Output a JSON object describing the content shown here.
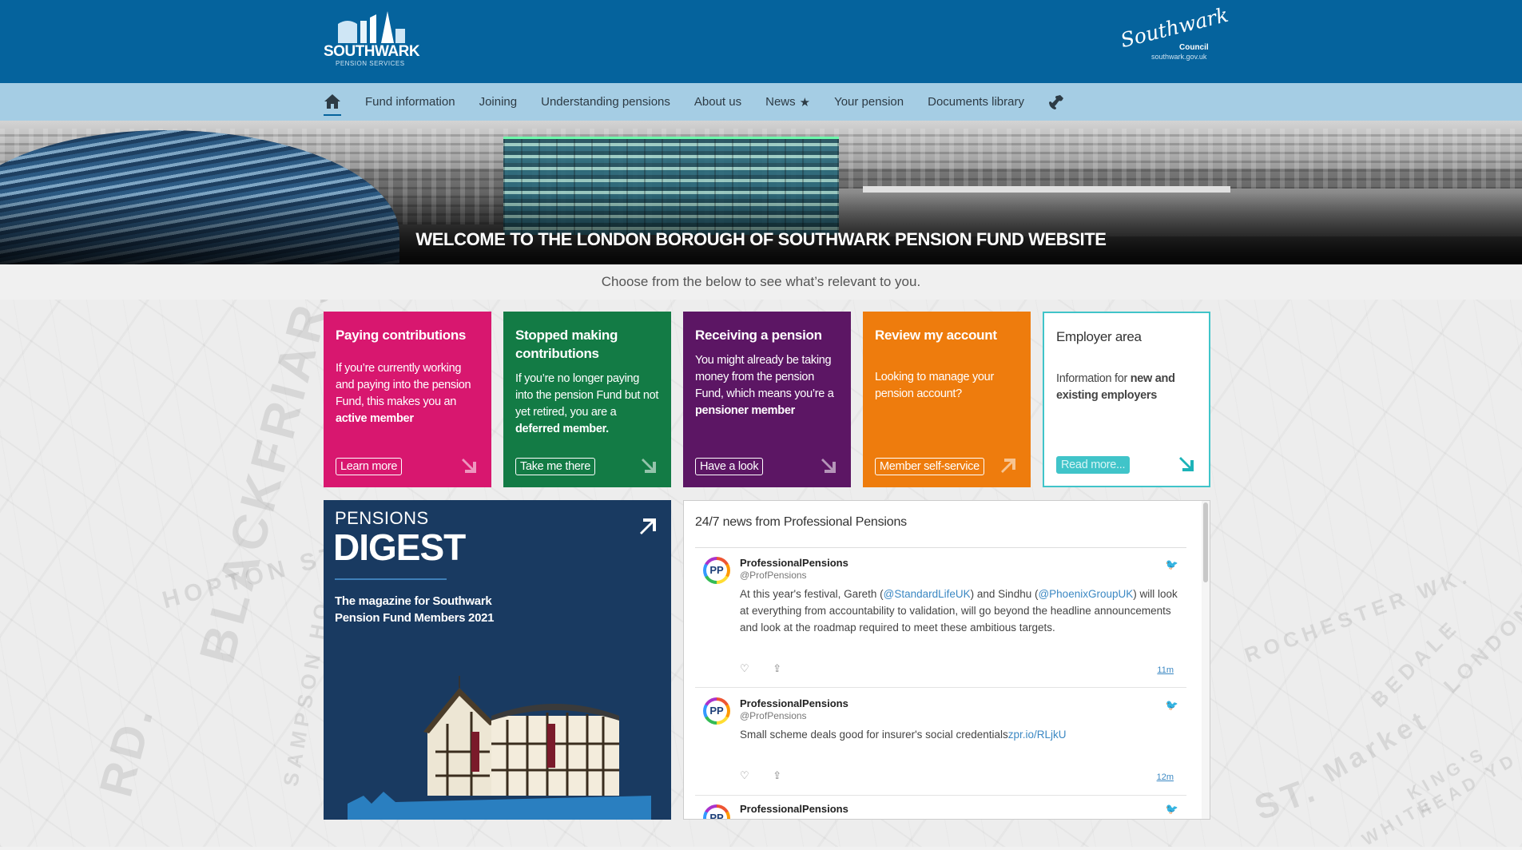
{
  "header": {
    "logo_main": "SOUTHWARK",
    "logo_sub": "PENSION SERVICES",
    "council_script": "Southwark",
    "council_label": "Council",
    "council_url": "southwark.gov.uk",
    "brand_color": "#05639d",
    "nav_color": "#a5cde4"
  },
  "nav": {
    "items": [
      "Fund information",
      "Joining",
      "Understanding pensions",
      "About us",
      "News",
      "Your pension",
      "Documents library"
    ],
    "icons": {
      "home": "home-icon",
      "news": "star-icon",
      "contact": "phone-icon"
    }
  },
  "hero": {
    "title": "WELCOME TO THE LONDON BOROUGH OF SOUTHWARK PENSION FUND WEBSITE"
  },
  "intro": "Choose from the below to see what’s relevant to you.",
  "cards": [
    {
      "title": "Paying contributions",
      "desc_before": "If you’re currently working and paying into the pension Fund, this makes you an ",
      "desc_bold": "active member",
      "desc_after": "",
      "button": "Learn more",
      "color": "#d8176f"
    },
    {
      "title": "Stopped making contributions",
      "desc_before": "If you’re no longer paying into the pension Fund but not yet retired, you are a ",
      "desc_bold": "deferred member.",
      "desc_after": "",
      "button": "Take me there",
      "color": "#137b45"
    },
    {
      "title": "Receiving a pension",
      "desc_before": "You might already be taking money from the pension Fund, which means you’re a ",
      "desc_bold": "pensioner",
      "desc_after": " member",
      "button": "Have a look",
      "color": "#5c1664"
    },
    {
      "title": "Review my account",
      "desc_before": "Looking to manage your pension account?",
      "desc_bold": "",
      "desc_after": "",
      "button": "Member self-service",
      "color": "#ee7c0d"
    },
    {
      "title": "Employer area",
      "desc_before": "Information for ",
      "desc_bold": "new and existing employers",
      "desc_after": "",
      "button": "Read more...",
      "color": "#40c4c9"
    }
  ],
  "digest": {
    "label_small": "PENSIONS",
    "label_big": "DIGEST",
    "tagline": "The magazine for Southwark Pension Fund Members 2021",
    "bg": "#193a61"
  },
  "news": {
    "heading": "24/7 news from Professional Pensions",
    "tweets": [
      {
        "avatar": "PP",
        "name": "ProfessionalPensions",
        "handle": "@ProfPensions",
        "t1": "At this year's festival, Gareth (",
        "l1": "@StandardLifeUK",
        "t2": ") and Sindhu (",
        "l2": "@PhoenixGroupUK",
        "t3": ") will look at everything from accountability to validation, will go beyond the headline announcements and look at the roadmap required to meet these ambitious targets.",
        "time": "11m"
      },
      {
        "avatar": "PP",
        "name": "ProfessionalPensions",
        "handle": "@ProfPensions",
        "t1": "Small scheme deals good for insurer's social credentials",
        "l1": "zpr.io/RLjkU",
        "time": "12m"
      },
      {
        "avatar": "PP",
        "name": "ProfessionalPensions"
      }
    ]
  },
  "map_words": [
    "BLACKFRIARS",
    "HOPTON ST.",
    "RD.",
    "SAMPSON HO.",
    "ROCHESTER WK.",
    "BEDALE",
    "Market",
    "LONDON",
    "KING'S HEAD YD",
    "ST.",
    "WHITE"
  ]
}
